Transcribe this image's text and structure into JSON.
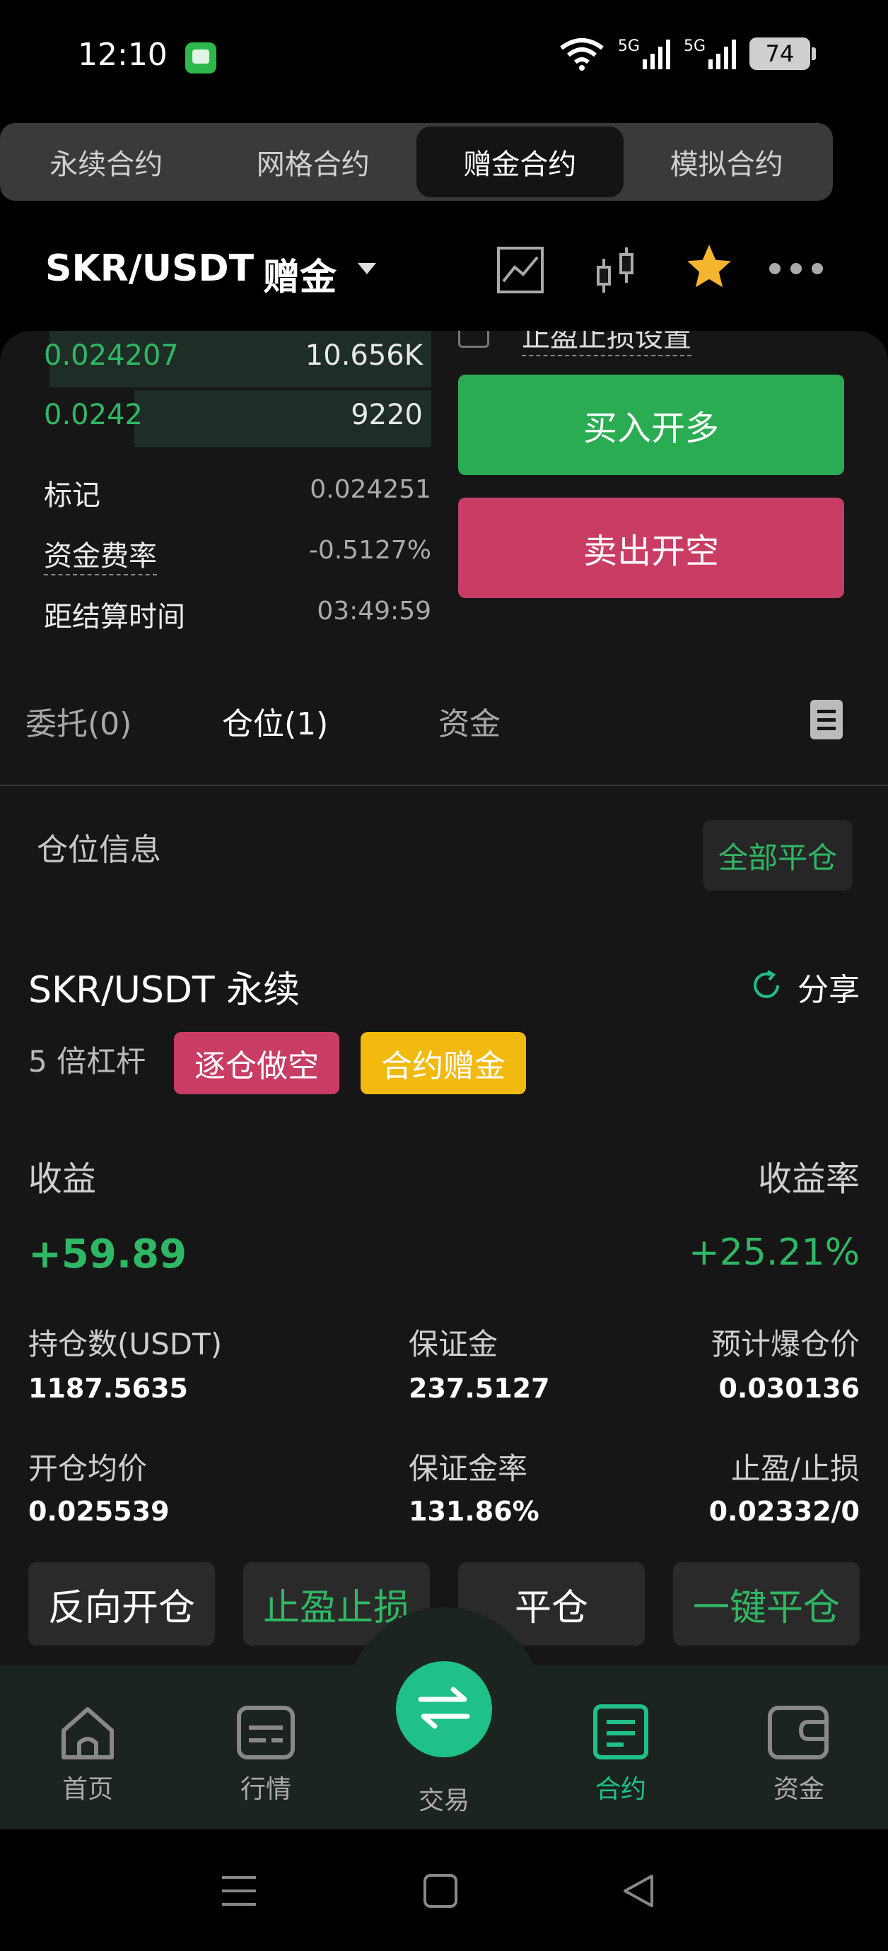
{
  "status_bar": {
    "time": "12:10",
    "net_1": "5G",
    "net_2": "5G",
    "battery": "74"
  },
  "contract_tabs": [
    {
      "label": "永续合约"
    },
    {
      "label": "网格合约"
    },
    {
      "label": "赠金合约"
    },
    {
      "label": "模拟合约"
    }
  ],
  "pair": {
    "name": "SKR/USDT",
    "mode": "赠金"
  },
  "order_book": [
    {
      "price": "0.024207",
      "qty": "10.656K"
    },
    {
      "price": "0.0242",
      "qty": "9220"
    }
  ],
  "market_info": {
    "mark_label": "标记",
    "mark_value": "0.024251",
    "funding_label": "资金费率",
    "funding_value": "-0.5127%",
    "settle_label": "距结算时间",
    "settle_value": "03:49:59"
  },
  "tpsl_setting_label": "止盈止损设置",
  "actions": {
    "buy_long": "买入开多",
    "sell_short": "卖出开空"
  },
  "position_tabs": [
    {
      "label": "委托(0)"
    },
    {
      "label": "仓位(1)"
    },
    {
      "label": "资金"
    }
  ],
  "position_section": {
    "title": "仓位信息",
    "close_all": "全部平仓"
  },
  "position": {
    "title": "SKR/USDT 永续",
    "share": "分享",
    "leverage": "5 倍杠杆",
    "tag_side": "逐仓做空",
    "tag_bonus": "合约赠金",
    "pnl_label": "收益",
    "pnl_rate_label": "收益率",
    "pnl_value": "+59.89",
    "pnl_rate_value": "+25.21%",
    "size_label": "持仓数(USDT)",
    "size_value": "1187.5635",
    "margin_label": "保证金",
    "margin_value": "237.5127",
    "liq_label": "预计爆仓价",
    "liq_value": "0.030136",
    "entry_label": "开仓均价",
    "entry_value": "0.025539",
    "margin_rate_label": "保证金率",
    "margin_rate_value": "131.86%",
    "tpsl_label": "止盈/止损",
    "tpsl_value": "0.02332/0"
  },
  "position_buttons": {
    "reverse": "反向开仓",
    "tpsl": "止盈止损",
    "close": "平仓",
    "close_one_click": "一键平仓"
  },
  "bottom_nav": {
    "home": "首页",
    "market": "行情",
    "trade": "交易",
    "contract": "合约",
    "assets": "资金"
  },
  "colors": {
    "green": "#2fb864",
    "accent": "#1fc08a",
    "red": "#c93d64",
    "gold": "#f2b90f"
  }
}
